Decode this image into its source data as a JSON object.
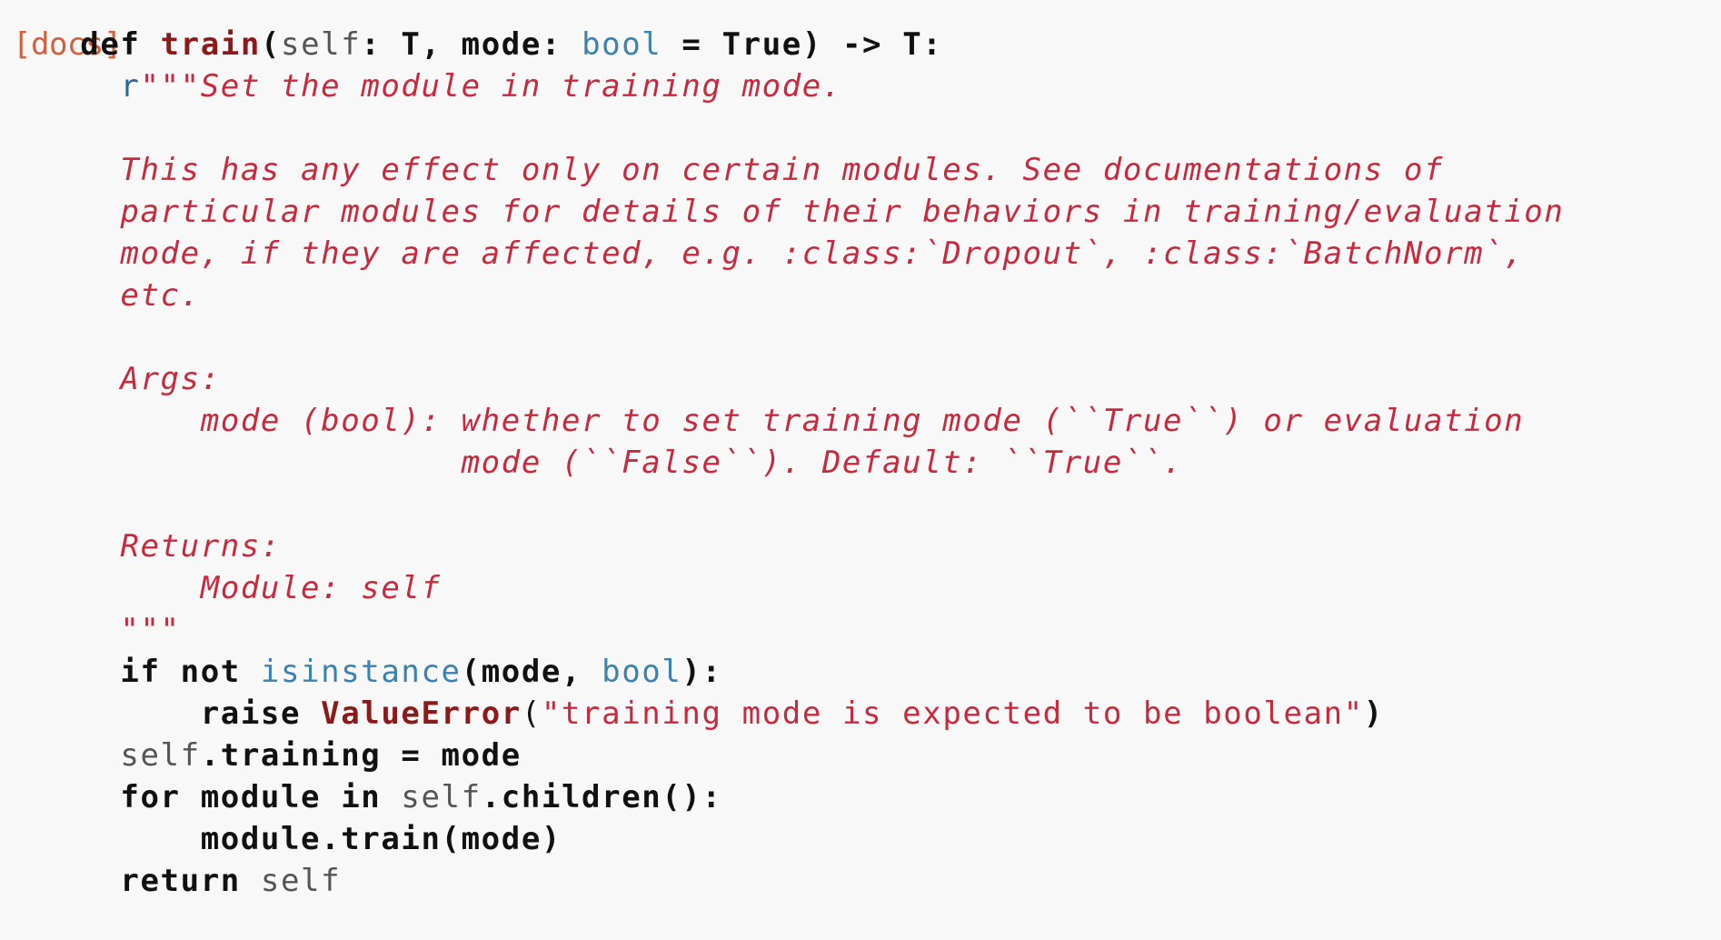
{
  "docs_link": "[docs]",
  "colors": {
    "background": "#f8f8f8",
    "keyword": "#111111",
    "function_name": "#8b1a1a",
    "builtin": "#3a82b0",
    "self": "#555555",
    "docstring": "#c8293c",
    "docs_link": "#d35f3e"
  },
  "code": {
    "l01": {
      "indent": "    ",
      "kw_def": "def",
      "sp1": " ",
      "fn": "train",
      "p1": "(",
      "self": "self",
      "p2": ": T, mode: ",
      "bi": "bool",
      "p3": " = True) -> T:"
    },
    "l02": {
      "indent": "      ",
      "prefix": "r",
      "doc": "\"\"\"Set the module in training mode."
    },
    "l03": {
      "text": ""
    },
    "l04": {
      "indent": "      ",
      "doc": "This has any effect only on certain modules. See documentations of"
    },
    "l05": {
      "indent": "      ",
      "doc": "particular modules for details of their behaviors in training/evaluation"
    },
    "l06": {
      "indent": "      ",
      "doc": "mode, if they are affected, e.g. :class:`Dropout`, :class:`BatchNorm`,"
    },
    "l07": {
      "indent": "      ",
      "doc": "etc."
    },
    "l08": {
      "text": ""
    },
    "l09": {
      "indent": "      ",
      "doc": "Args:"
    },
    "l10": {
      "indent": "      ",
      "doc": "    mode (bool): whether to set training mode (``True``) or evaluation"
    },
    "l11": {
      "indent": "      ",
      "doc": "                 mode (``False``). Default: ``True``."
    },
    "l12": {
      "text": ""
    },
    "l13": {
      "indent": "      ",
      "doc": "Returns:"
    },
    "l14": {
      "indent": "      ",
      "doc": "    Module: self"
    },
    "l15": {
      "indent": "      ",
      "doc": "\"\"\""
    },
    "l16": {
      "indent": "      ",
      "kw_if": "if",
      "kw_not": " not ",
      "bi1": "isinstance",
      "p1": "(mode, ",
      "bi2": "bool",
      "p2": "):"
    },
    "l17": {
      "indent": "          ",
      "kw_raise": "raise",
      "sp": " ",
      "fn": "ValueError",
      "p1": "(",
      "str": "\"training mode is expected to be boolean\"",
      "p2": ")"
    },
    "l18": {
      "indent": "      ",
      "self": "self",
      "rest": ".training = mode"
    },
    "l19": {
      "indent": "      ",
      "kw_for": "for",
      "p1": " module ",
      "kw_in": "in",
      "sp": " ",
      "self": "self",
      "p2": ".children():"
    },
    "l20": {
      "indent": "          ",
      "text": "module.train(mode)"
    },
    "l21": {
      "indent": "      ",
      "kw_return": "return",
      "sp": " ",
      "self": "self"
    }
  }
}
